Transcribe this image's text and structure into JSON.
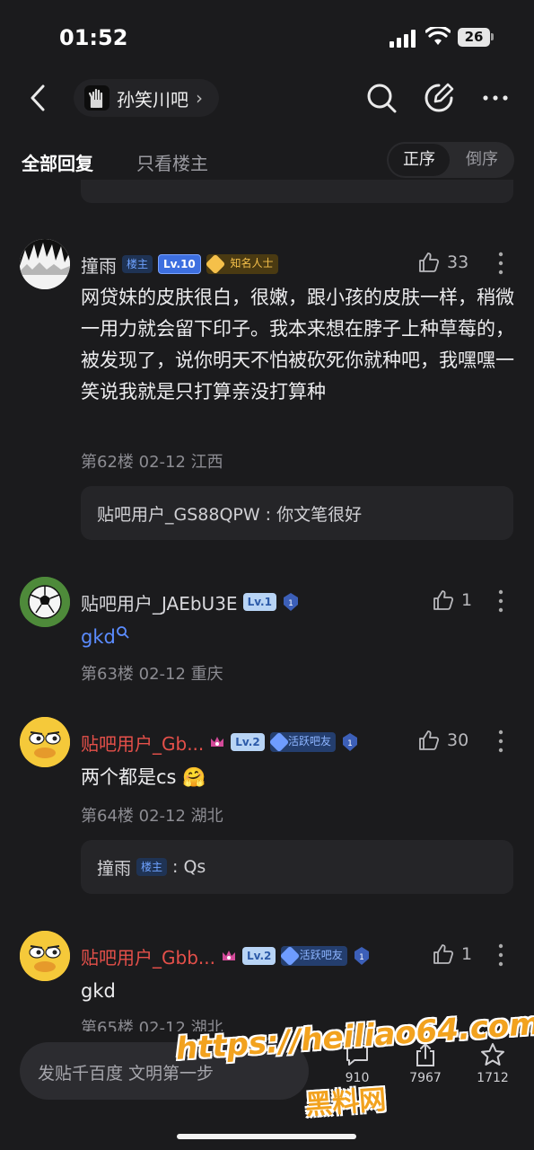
{
  "status_bar": {
    "time": "01:52",
    "battery": "26"
  },
  "nav": {
    "forum_name": "孙笑川吧",
    "chevron": "›"
  },
  "filter": {
    "all_replies": "全部回复",
    "only_owner": "只看楼主",
    "sort_asc": "正序",
    "sort_desc": "倒序"
  },
  "posts": [
    {
      "username": "撞雨",
      "badges": {
        "owner": "楼主",
        "level": "Lv.10",
        "fame_num": "10",
        "fame": "知名人士"
      },
      "likes": "33",
      "content": "网贷妹的皮肤很白，很嫩，跟小孩的皮肤一样，稍微一用力就会留下印子。我本来想在脖子上种草莓的，被发现了，说你明天不怕被砍死你就种吧，我嘿嘿一笑说我就是只打算亲没打算种",
      "meta": "第62楼 02-12 江西",
      "reply": {
        "author": "贴吧用户_GS88QPW",
        "text": ": 你文笔很好"
      }
    },
    {
      "username": "贴吧用户_JAEbU3E",
      "badges": {
        "level": "Lv.1",
        "shield": "1"
      },
      "likes": "1",
      "content": "gkd",
      "meta": "第63楼 02-12 重庆"
    },
    {
      "username": "贴吧用户_Gb...",
      "badges": {
        "level": "Lv.2",
        "active_num": "4",
        "active": "活跃吧友",
        "shield": "1"
      },
      "likes": "30",
      "content": "两个都是cs",
      "emoji": "🤗",
      "meta": "第64楼 02-12 湖北",
      "reply": {
        "author": "撞雨",
        "owner": "楼主",
        "text": ": Qs"
      }
    },
    {
      "username": "贴吧用户_Gbb...",
      "badges": {
        "level": "Lv.2",
        "active_num": "4",
        "active": "活跃吧友",
        "shield": "1"
      },
      "likes": "1",
      "content": "gkd",
      "meta": "第65楼 02-12 湖北"
    }
  ],
  "bottom": {
    "compose_placeholder": "发贴千百度 文明第一步",
    "comments": "910",
    "shares": "7967",
    "favorites": "1712"
  },
  "watermark": {
    "url": "https://heiliao64.com",
    "name": "黑料网"
  },
  "colors": {
    "background": "#1b1b1d",
    "accent_blue": "#5b8cff",
    "username_red": "#e5504a",
    "watermark_orange": "#f2a21e"
  }
}
